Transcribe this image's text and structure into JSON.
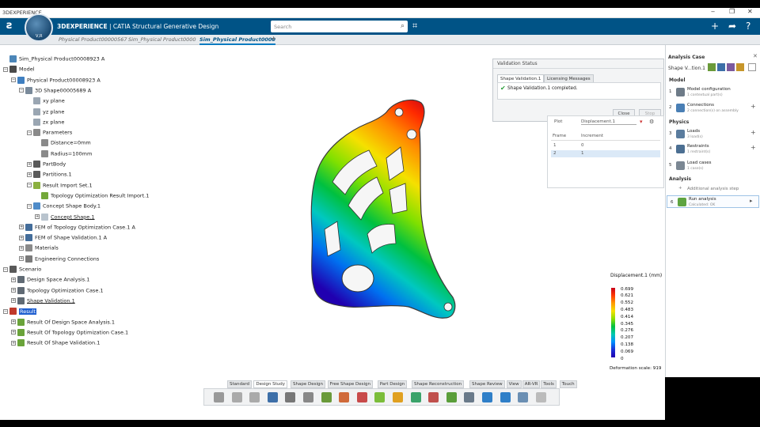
{
  "window": {
    "app_title": "3DEXPERIENCE",
    "minimize_glyph": "‒",
    "restore_glyph": "❐",
    "close_glyph": "✕"
  },
  "appbar": {
    "brand_bold": "3DEXPERIENCE",
    "brand_rest": " | CATIA Structural Generative Design",
    "compass_label": "V,R",
    "search_placeholder": "Search",
    "icons": [
      "search-icon",
      "tag-icon",
      "plus-icon",
      "share-icon",
      "help-icon"
    ]
  },
  "tabs": [
    {
      "label": "Physical Product00000567",
      "active": false
    },
    {
      "label": "Sim_Physical Product0000",
      "active": false
    },
    {
      "label": "Sim_Physical Product0000",
      "active": true
    }
  ],
  "tree": [
    {
      "label": "Sim_Physical Product00008923 A",
      "level": 0,
      "pm": "",
      "icon": "sim-icon"
    },
    {
      "label": "Model",
      "level": 0,
      "pm": "−",
      "icon": "model-icon"
    },
    {
      "label": "Physical Product00008923 A",
      "level": 1,
      "pm": "−",
      "icon": "product-icon"
    },
    {
      "label": "3D Shape00005689 A",
      "level": 2,
      "pm": "−",
      "icon": "shape-icon"
    },
    {
      "label": "xy plane",
      "level": 3,
      "pm": "",
      "icon": "plane-icon"
    },
    {
      "label": "yz plane",
      "level": 3,
      "pm": "",
      "icon": "plane-icon"
    },
    {
      "label": "zx plane",
      "level": 3,
      "pm": "",
      "icon": "plane-icon"
    },
    {
      "label": "Parameters",
      "level": 3,
      "pm": "−",
      "icon": "parameters-icon"
    },
    {
      "label": "Distance=0mm",
      "level": 4,
      "pm": "",
      "icon": "parameter-icon"
    },
    {
      "label": "Radius=100mm",
      "level": 4,
      "pm": "",
      "icon": "parameter-icon"
    },
    {
      "label": "PartBody",
      "level": 3,
      "pm": "+",
      "icon": "partbody-icon"
    },
    {
      "label": "Partitions.1",
      "level": 3,
      "pm": "+",
      "icon": "partitions-icon"
    },
    {
      "label": "Result Import Set.1",
      "level": 3,
      "pm": "−",
      "icon": "import-set-icon"
    },
    {
      "label": "Topology Optimization Result Import.1",
      "level": 4,
      "pm": "",
      "icon": "topology-result-icon"
    },
    {
      "label": "Concept Shape Body.1",
      "level": 3,
      "pm": "−",
      "icon": "concept-body-icon"
    },
    {
      "label": "Concept Shape.1",
      "level": 4,
      "pm": "+",
      "icon": "concept-shape-icon",
      "underline": true
    },
    {
      "label": "FEM of Topology Optimization Case.1 A",
      "level": 2,
      "pm": "+",
      "icon": "fem-icon"
    },
    {
      "label": "FEM of Shape Validation.1 A",
      "level": 2,
      "pm": "+",
      "icon": "fem-icon"
    },
    {
      "label": "Materials",
      "level": 2,
      "pm": "+",
      "icon": "materials-icon"
    },
    {
      "label": "Engineering Connections",
      "level": 2,
      "pm": "+",
      "icon": "connections-icon"
    },
    {
      "label": "Scenario",
      "level": 0,
      "pm": "−",
      "icon": "scenario-icon"
    },
    {
      "label": "Design Space Analysis.1",
      "level": 1,
      "pm": "+",
      "icon": "analysis-icon"
    },
    {
      "label": "Topology Optimization Case.1",
      "level": 1,
      "pm": "+",
      "icon": "analysis-icon"
    },
    {
      "label": "Shape Validation.1",
      "level": 1,
      "pm": "+",
      "icon": "analysis-icon",
      "underline": true
    },
    {
      "label": "Result",
      "level": 0,
      "pm": "−",
      "icon": "result-icon",
      "selected": true
    },
    {
      "label": "Result Of Design Space Analysis.1",
      "level": 1,
      "pm": "+",
      "icon": "result-item-icon"
    },
    {
      "label": "Result Of Topology Optimization Case.1",
      "level": 1,
      "pm": "+",
      "icon": "result-item-icon"
    },
    {
      "label": "Result Of Shape Validation.1",
      "level": 1,
      "pm": "+",
      "icon": "result-item-icon"
    }
  ],
  "validation_dialog": {
    "title": "Validation Status",
    "tab_active": "Shape Validation.1",
    "tab_other": "Licensing Messages",
    "message": "Shape Validation.1 completed.",
    "close_label": "Close",
    "stop_label": "Stop"
  },
  "frame_panel": {
    "plot_label": "Plot",
    "plot_value": "Displacement.1",
    "columns": [
      "Frame",
      "Increment"
    ],
    "rows": [
      [
        "1",
        "0"
      ],
      [
        "2",
        "1"
      ]
    ]
  },
  "legend": {
    "title": "Displacement.1 (mm)",
    "ticks": [
      "0.699",
      "0.621",
      "0.552",
      "0.483",
      "0.414",
      "0.345",
      "0.276",
      "0.207",
      "0.138",
      "0.069",
      "0"
    ],
    "deformation_label": "Deformation scale: 919"
  },
  "right_panel": {
    "title": "Analysis Case",
    "case_name": "Shape V...tion.1",
    "sections": {
      "model": "Model",
      "physics": "Physics",
      "analysis": "Analysis"
    },
    "items": [
      {
        "num": "1",
        "title": "Model configuration",
        "sub": "1 contextual part(s)",
        "plus": false
      },
      {
        "num": "2",
        "title": "Connections",
        "sub": "2 connection(s) on assembly",
        "plus": true
      },
      {
        "num": "3",
        "title": "Loads",
        "sub": "3 load(s)",
        "plus": true
      },
      {
        "num": "4",
        "title": "Restraints",
        "sub": "1 restraint(s)",
        "plus": true
      },
      {
        "num": "5",
        "title": "Load cases",
        "sub": "1 case(s)",
        "plus": false
      }
    ],
    "additional_step": "Additional analysis step",
    "run": {
      "num": "6",
      "title": "Run analysis",
      "sub": "Calculated: OK"
    }
  },
  "bottom_tabs": [
    {
      "label": "Standard",
      "active": false
    },
    {
      "label": "Design Study",
      "active": true
    },
    {
      "label": "Shape Design",
      "active": false
    },
    {
      "label": "Free Shape Design",
      "active": false
    },
    {
      "label": "Part Design",
      "active": false
    },
    {
      "label": "Shape Reconstruction",
      "active": false
    },
    {
      "label": "Shape Review",
      "active": false
    },
    {
      "label": "View",
      "active": false
    },
    {
      "label": "AR-VR",
      "active": false
    },
    {
      "label": "Tools",
      "active": false
    },
    {
      "label": "Touch",
      "active": false
    }
  ],
  "colors": {
    "appbar": "#005386",
    "selection": "#1f5fd0",
    "accent": "#0a7cc1"
  }
}
